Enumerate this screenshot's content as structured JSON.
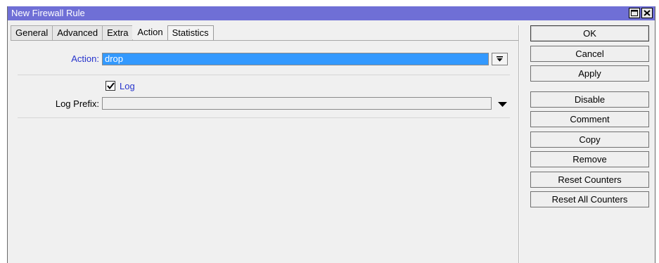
{
  "window": {
    "title": "New Firewall Rule"
  },
  "titlebar": {
    "restore_icon": "restore-icon",
    "close_icon": "close-icon"
  },
  "tabs": [
    {
      "label": "General"
    },
    {
      "label": "Advanced"
    },
    {
      "label": "Extra"
    },
    {
      "label": "Action",
      "active": true
    },
    {
      "label": "Statistics"
    }
  ],
  "action_tab": {
    "action_label": "Action:",
    "action_value": "drop",
    "log_label": "Log",
    "log_checked": true,
    "log_prefix_label": "Log Prefix:",
    "log_prefix_value": ""
  },
  "buttons": {
    "ok": "OK",
    "cancel": "Cancel",
    "apply": "Apply",
    "disable": "Disable",
    "comment": "Comment",
    "copy": "Copy",
    "remove": "Remove",
    "reset_counters": "Reset Counters",
    "reset_all_counters": "Reset All Counters"
  },
  "colors": {
    "titlebar": "#6f6fd6",
    "selection": "#3399ff",
    "label_accent": "#2633cc"
  }
}
